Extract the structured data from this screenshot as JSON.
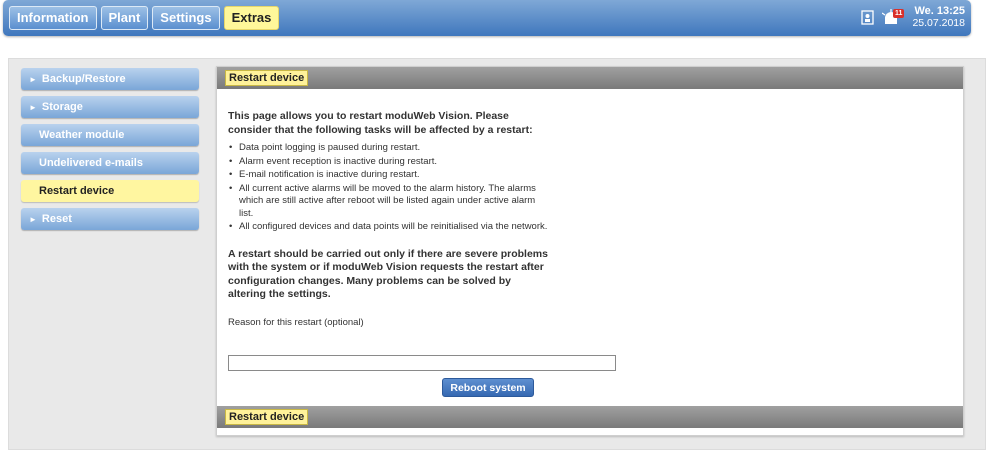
{
  "topnav": {
    "tabs": [
      {
        "label": "Information"
      },
      {
        "label": "Plant"
      },
      {
        "label": "Settings"
      },
      {
        "label": "Extras"
      }
    ]
  },
  "status": {
    "alarm_count": "11",
    "clock_time": "We. 13:25",
    "clock_date": "25.07.2018"
  },
  "sidebar": {
    "items": [
      {
        "label": "Backup/Restore"
      },
      {
        "label": "Storage"
      },
      {
        "label": "Weather module"
      },
      {
        "label": "Undelivered e-mails"
      },
      {
        "label": "Restart device"
      },
      {
        "label": "Reset"
      }
    ]
  },
  "content": {
    "header_title": "Restart device",
    "footer_title": "Restart device",
    "intro": "This page allows you to restart moduWeb Vision. Please consider that the following tasks will be affected by a restart:",
    "bullets": [
      "Data point logging is paused during restart.",
      "Alarm event reception is inactive during restart.",
      "E-mail notification is inactive during restart.",
      "All current active alarms will be moved to the alarm history. The alarms which are still active after reboot will be listed again under active alarm list.",
      "All configured devices and data points will be reinitialised via the network."
    ],
    "warning": "A restart should be carried out only if there are severe problems with the system or if moduWeb Vision requests the restart after configuration changes. Many problems can be solved by altering the settings.",
    "reason_label": "Reason for this restart (optional)",
    "reason_value": "",
    "reboot_label": "Reboot system"
  },
  "colors": {
    "accent": "#3f77bd",
    "active": "#fff6a0",
    "alarm": "#d9302a"
  }
}
